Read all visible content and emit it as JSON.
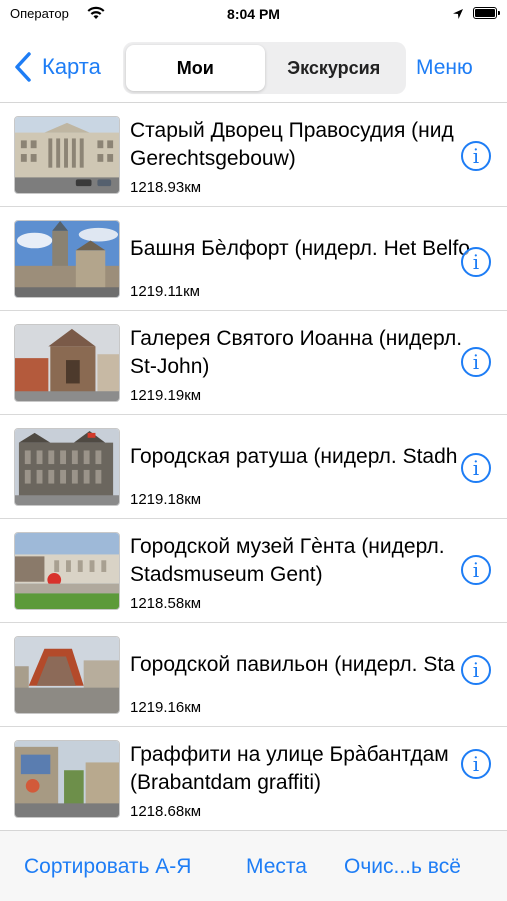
{
  "status_bar": {
    "carrier": "Оператор",
    "time": "8:04 PM"
  },
  "nav": {
    "back_label": "Карта",
    "segments": [
      "Мои",
      "Экскурсия"
    ],
    "menu_label": "Меню"
  },
  "items": [
    {
      "title": "Старый Дворец Правосудия (нидерл. Gerechtsgebouw)",
      "line1": "Старый Дворец Правосудия (нид",
      "line2": "Gerechtsgebouw)",
      "distance": "1218.93км"
    },
    {
      "title": "Башня Бѐлфорт (нидерл. Het Belfort)",
      "line1": "Башня Бѐлфорт (нидерл. Het Belfo",
      "distance": "1219.11км"
    },
    {
      "title": "Галерея Святого Иоанна (нидерл. St-John)",
      "line1": "Галерея Святого Иоанна (нидерл.",
      "line2": "St-John)",
      "distance": "1219.19км"
    },
    {
      "title": "Городская ратуша (нидерл. Stadhuis)",
      "line1": "Городская ратуша (нидерл. Stadh",
      "distance": "1219.18км"
    },
    {
      "title": "Городской музей Гѐнта (нидерл. Stadsmuseum Gent)",
      "line1": "Городской музей Гѐнта (нидерл.",
      "line2": "Stadsmuseum Gent)",
      "distance": "1218.58км"
    },
    {
      "title": "Городской павильон (нидерл. Stadshal)",
      "line1": "Городской павильон (нидерл. Sta",
      "distance": "1219.16км"
    },
    {
      "title": "Граффити на улице Брàбантдам (Brabantdam graffiti)",
      "line1": "Граффити на улице Брàбантдам",
      "line2": "(Brabantdam graffiti)",
      "distance": "1218.68км"
    }
  ],
  "toolbar": {
    "sort_label": "Сортировать А-Я",
    "places_label": "Места",
    "clear_label": "Очис...ь всё"
  },
  "colors": {
    "accent": "#1e7df5"
  }
}
